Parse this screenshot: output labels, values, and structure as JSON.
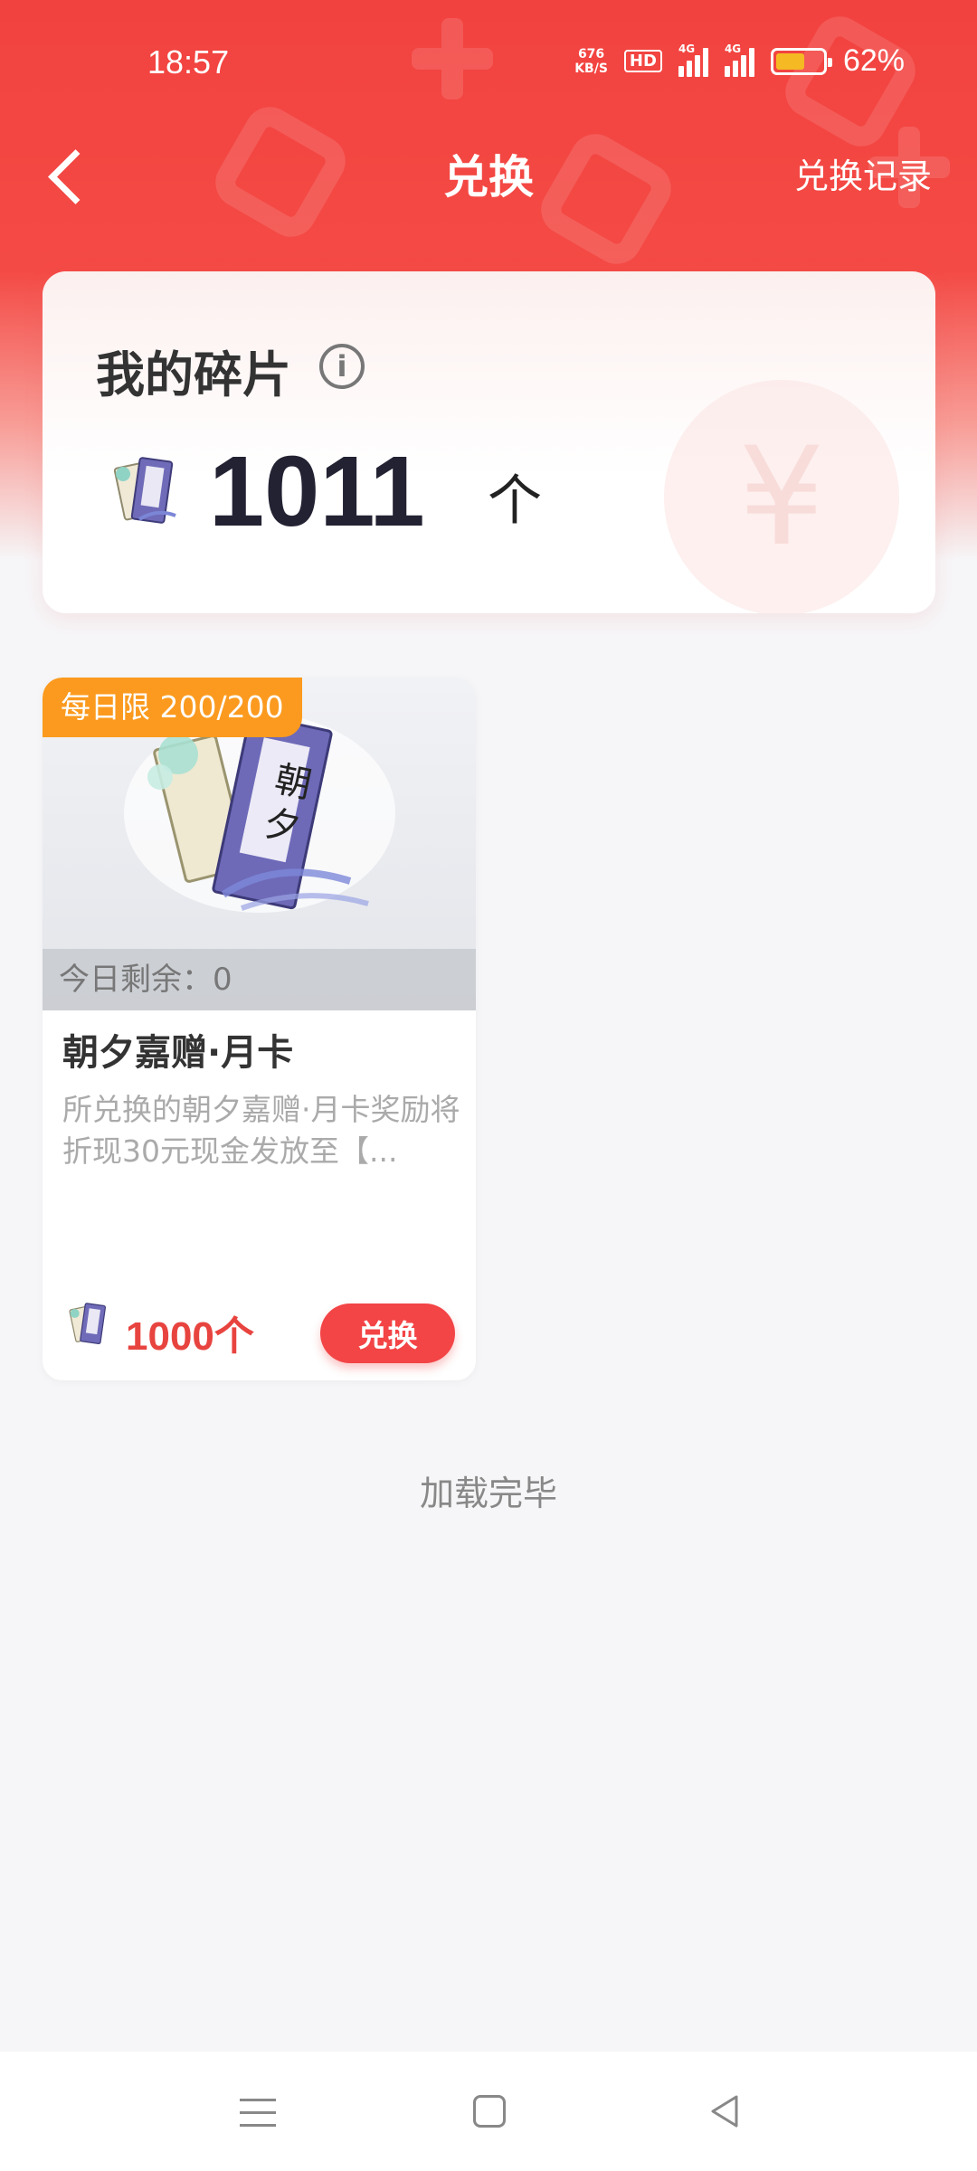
{
  "status_bar": {
    "time": "18:57",
    "net_speed_value": "676",
    "net_speed_unit": "KB/S",
    "hd_label": "HD",
    "signal_1_label": "4G",
    "signal_2_label": "4G",
    "battery_percent": "62%",
    "battery_level": 0.62,
    "battery_color": "#f5b923"
  },
  "nav": {
    "back_icon": "chevron-left-icon",
    "title": "兑换",
    "record_label": "兑换记录"
  },
  "fragments": {
    "title": "我的碎片",
    "info_icon": "info-icon",
    "count": "1011",
    "unit": "个",
    "bg_symbol": "¥"
  },
  "products": [
    {
      "limit_badge": "每日限 200/200",
      "remain_label": "今日剩余：0",
      "name": "朝夕嘉赠·月卡",
      "description": "所兑换的朝夕嘉赠·月卡奖励将折现30元现金发放至【...",
      "price": "1000个",
      "button_label": "兑换",
      "image_text": "朝夕"
    }
  ],
  "footer": {
    "loaded_text": "加载完毕"
  },
  "colors": {
    "header_red": "#f2423f",
    "accent_red": "#f34446",
    "badge_orange": "#fb9a1e",
    "price_red": "#e8443f"
  }
}
